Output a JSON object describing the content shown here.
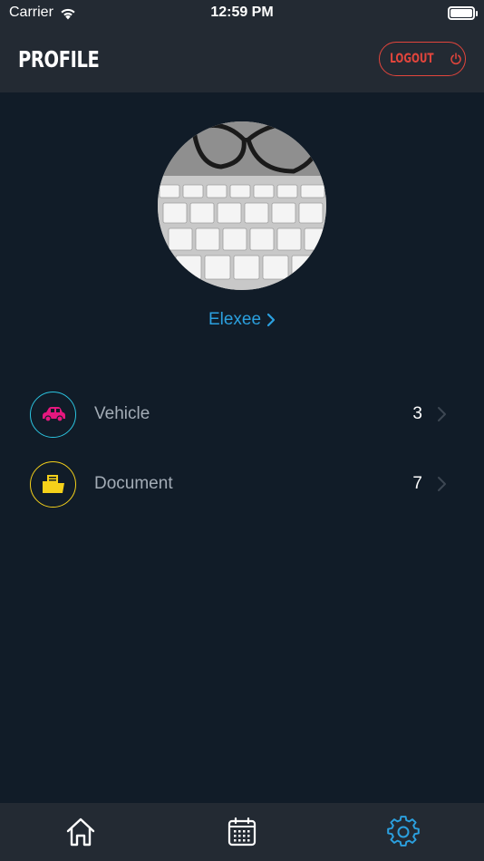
{
  "status_bar": {
    "carrier": "Carrier",
    "time": "12:59 PM"
  },
  "header": {
    "title": "PROFILE",
    "logout_label": "LOGOUT"
  },
  "profile": {
    "username": "Elexee"
  },
  "menu": {
    "items": [
      {
        "label": "Vehicle",
        "count": "3",
        "icon": "car-icon",
        "accent": "#e6177f",
        "ring": "#2bc4e0"
      },
      {
        "label": "Document",
        "count": "7",
        "icon": "folder-icon",
        "accent": "#f5d11a",
        "ring": "#f5d11a"
      }
    ]
  },
  "tab_bar": {
    "tabs": [
      {
        "icon": "home-icon",
        "active": false
      },
      {
        "icon": "calendar-icon",
        "active": false
      },
      {
        "icon": "settings-gear-icon",
        "active": true
      }
    ]
  },
  "colors": {
    "background": "#111c28",
    "bar": "#232a33",
    "logout": "#e2453c",
    "link": "#2ba0df",
    "active_tab": "#2ba0df"
  }
}
